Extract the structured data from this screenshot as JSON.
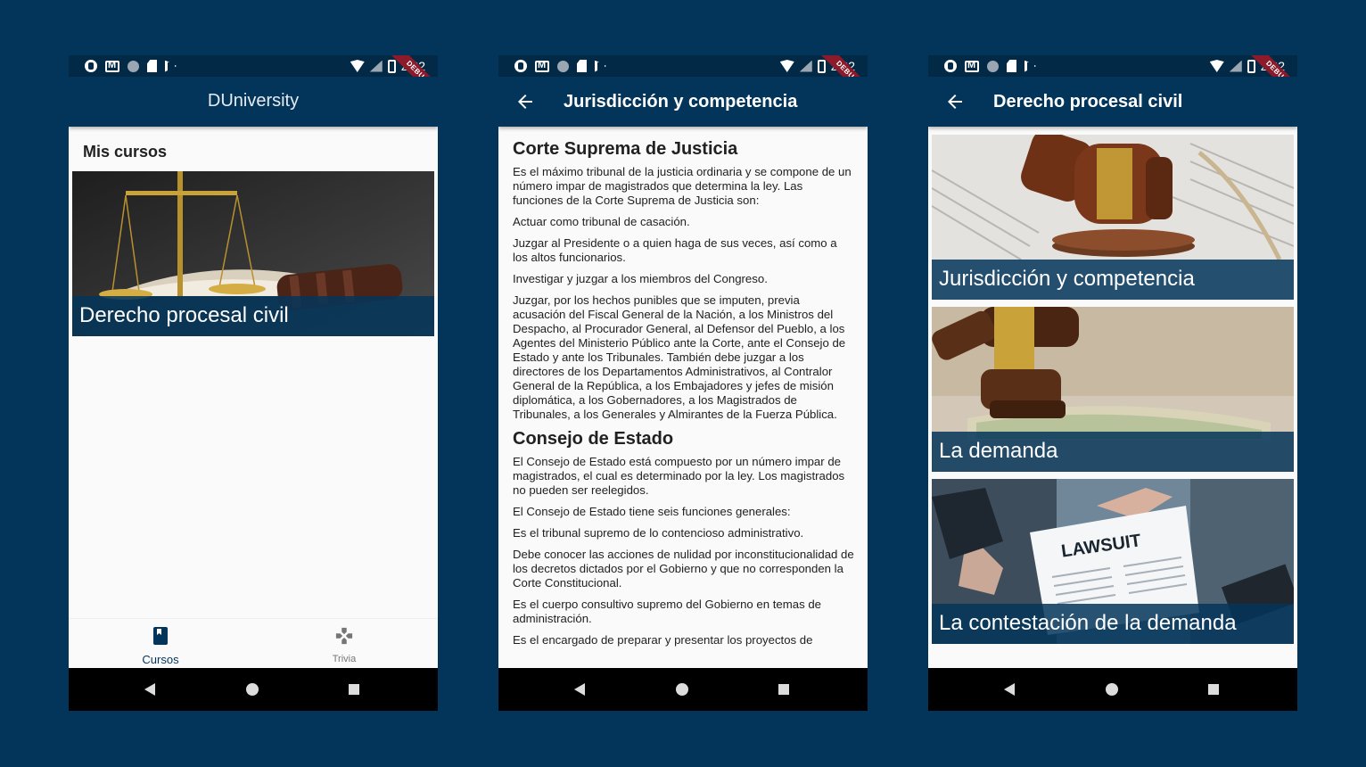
{
  "status_bar": {
    "time": "2:32",
    "debug_label": "DEBUG"
  },
  "phone1": {
    "app_title": "DUniversity",
    "section_title": "Mis cursos",
    "courses": [
      {
        "title": "Derecho procesal civil"
      }
    ],
    "bottom_nav": [
      {
        "label": "Cursos",
        "icon": "book-icon",
        "active": true
      },
      {
        "label": "Trivia",
        "icon": "gamepad-icon",
        "active": false
      }
    ]
  },
  "phone2": {
    "title": "Jurisdicción y competencia",
    "sections": [
      {
        "heading": "Corte Suprema de Justicia",
        "paragraphs": [
          "Es el máximo tribunal de la justicia ordinaria y se compone de un número impar de magistrados que determina la ley. Las funciones de la Corte Suprema de Justicia son:",
          "Actuar como tribunal de casación.",
          "Juzgar al Presidente o a quien haga de sus veces, así como a los altos funcionarios.",
          "Investigar y juzgar a los miembros del Congreso.",
          "Juzgar, por los hechos punibles que se imputen, previa acusación del Fiscal General de la Nación, a los Ministros del Despacho, al Procurador General, al Defensor del Pueblo, a los Agentes del Ministerio Público ante la Corte, ante el Consejo de Estado y ante los Tribunales. También debe juzgar a los directores de los Departamentos Administrativos, al Contralor General de la República, a los Embajadores y jefes de misión diplomática, a los Gobernadores, a los Magistrados de Tribunales, a los Generales y Almirantes de la Fuerza Pública."
        ]
      },
      {
        "heading": "Consejo de Estado",
        "paragraphs": [
          "El Consejo de Estado está compuesto por un número impar de magistrados, el cual es determinado por la ley. Los magistrados no pueden ser reelegidos.",
          "El Consejo de Estado tiene seis funciones generales:",
          "Es el tribunal supremo de lo contencioso administrativo.",
          "Debe conocer las acciones de nulidad por inconstitucionalidad de los decretos dictados por el Gobierno y que no corresponden la Corte Constitucional.",
          "Es el cuerpo consultivo supremo del Gobierno en temas de administración.",
          "Es el encargado de preparar y presentar los proyectos de"
        ]
      }
    ]
  },
  "phone3": {
    "title": "Derecho procesal civil",
    "topics": [
      {
        "title": "Jurisdicción y competencia"
      },
      {
        "title": "La demanda"
      },
      {
        "title": "La contestación de la demanda"
      }
    ],
    "lawsuit_text": "LAWSUIT"
  }
}
